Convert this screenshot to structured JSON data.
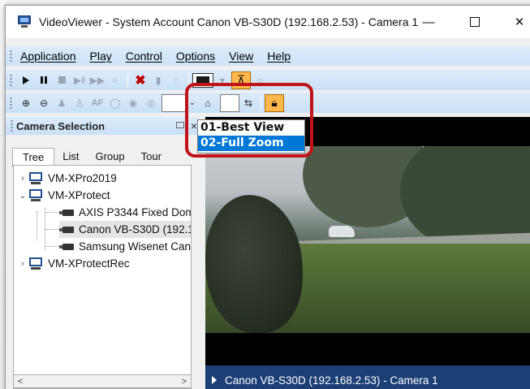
{
  "window": {
    "title": "VideoViewer - System Account Canon VB-S30D (192.168.2.53) - Camera 1",
    "minimize_glyph": "—",
    "close_glyph": "✕"
  },
  "menu": {
    "items": [
      "Application",
      "Play",
      "Control",
      "Options",
      "View",
      "Help"
    ]
  },
  "toolbar1": {
    "icons": [
      "play-icon",
      "pause-icon",
      "stop-icon",
      "step-forward-icon",
      "fast-forward-icon",
      "binoculars-icon",
      "delete-icon",
      "camera-icon",
      "monitor-icon",
      "layout-icon",
      "record-icon"
    ]
  },
  "toolbar2": {
    "icons": [
      "zoom-in-icon",
      "zoom-out-icon",
      "person-icon",
      "person-small-icon",
      "autofocus-icon",
      "iris-open-icon",
      "iris-close-icon",
      "iris-icon",
      "home-icon",
      "preset-save-icon",
      "lock-icon"
    ],
    "af_label": "AF"
  },
  "panel": {
    "title": "Camera Selection",
    "close_glyph": "×",
    "tabs": [
      "Tree",
      "List",
      "Group",
      "Tour"
    ],
    "active_tab": "Tree",
    "tree": [
      {
        "label": "VM-XPro2019",
        "type": "server",
        "expanded": false
      },
      {
        "label": "VM-XProtect",
        "type": "server",
        "expanded": true
      },
      {
        "label": "AXIS P3344 Fixed Dom",
        "type": "camera"
      },
      {
        "label": "Canon VB-S30D (192.1",
        "type": "camera",
        "selected": true
      },
      {
        "label": "Samsung Wisenet Can",
        "type": "camera"
      },
      {
        "label": "VM-XProtectRec",
        "type": "server",
        "expanded": false
      }
    ],
    "scroll_left": "<",
    "scroll_right": ">"
  },
  "preset_dropdown": {
    "options": [
      "01-Best View",
      "02-Full Zoom"
    ],
    "highlighted": "02-Full Zoom"
  },
  "video": {
    "caption": "Canon VB-S30D (192.168.2.53) - Camera 1"
  },
  "colors": {
    "highlight": "#c0141a",
    "selection": "#0078d7",
    "caption_bg": "#1c3f75"
  }
}
